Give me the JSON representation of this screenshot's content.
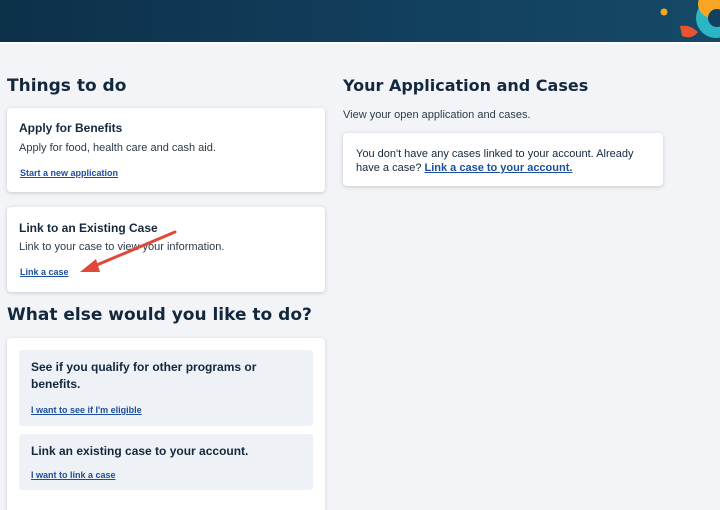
{
  "header": {
    "accent_colors": [
      "#f6a623",
      "#e8542e",
      "#2bb6c6"
    ]
  },
  "things_to_do": {
    "heading": "Things to do",
    "apply": {
      "title": "Apply for Benefits",
      "description": "Apply for food, health care and cash aid.",
      "link": "Start a new application"
    },
    "link_case": {
      "title": "Link to an Existing Case",
      "description": "Link to your case to view your information.",
      "link": "Link a case"
    }
  },
  "applications": {
    "heading": "Your Application and Cases",
    "description": "View your open application and cases.",
    "empty_text": "You don't have any cases linked to your account. Already have a case? ",
    "empty_link": "Link a case to your account."
  },
  "what_else": {
    "heading": "What else would you like to do?",
    "qualify": {
      "title": "See if you qualify for other programs or benefits.",
      "link": "I want to see if I'm eligible"
    },
    "link_existing": {
      "title": "Link an existing case to your account.",
      "link": "I want to link a case"
    }
  },
  "annotation": {
    "color": "#e0483a",
    "icon": "red-arrow-icon"
  }
}
